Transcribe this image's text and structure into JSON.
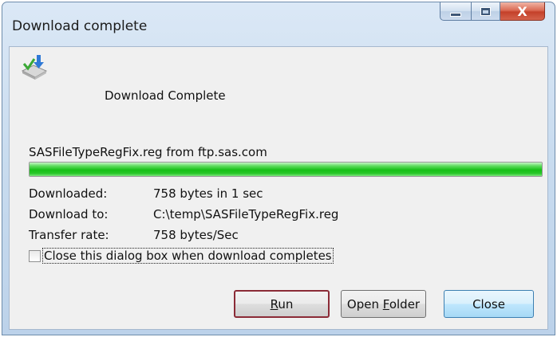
{
  "window": {
    "title": "Download complete",
    "controls": {
      "minimize_icon": "minimize-icon",
      "maximize_icon": "maximize-icon",
      "close_glyph": "X"
    }
  },
  "header": {
    "icon": "download-complete-icon",
    "heading": "Download Complete"
  },
  "download": {
    "source": "SASFileTypeRegFix.reg from ftp.sas.com",
    "progress": 1.0,
    "progress_color": "#16c016"
  },
  "details": [
    {
      "label": "Downloaded:",
      "value": "758 bytes in 1 sec"
    },
    {
      "label": "Download to:",
      "value": "C:\\temp\\SASFileTypeRegFix.reg"
    },
    {
      "label": "Transfer rate:",
      "value": "758 bytes/Sec"
    }
  ],
  "option": {
    "label": "Close this dialog box when download completes",
    "checked": false
  },
  "buttons": {
    "run": {
      "mnemonic": "R",
      "rest": "un"
    },
    "open_folder": {
      "prefix": "Open ",
      "mnemonic": "F",
      "rest": "older"
    },
    "close": "Close"
  }
}
